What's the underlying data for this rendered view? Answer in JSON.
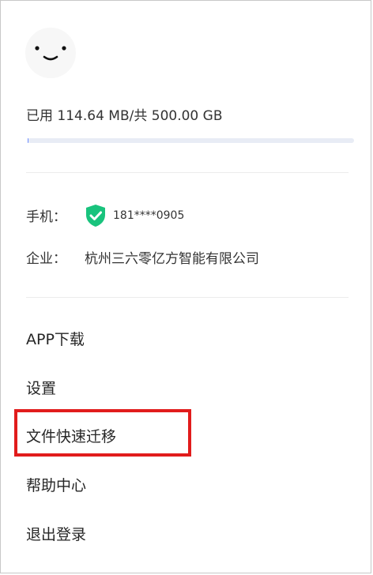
{
  "profile": {
    "avatar_icon": "smiley-face-icon"
  },
  "storage": {
    "text": "已用 114.64 MB/共 500.00 GB",
    "used_fraction": 0.0002,
    "track_color": "#e8ecf5",
    "fill_color": "#6b8cff"
  },
  "info": {
    "phone_label": "手机：",
    "phone_value": "181****0905",
    "verified_icon": "shield-check-icon",
    "verified_color": "#19c37d",
    "company_label": "企业：",
    "company_value": "杭州三六零亿方智能有限公司"
  },
  "menu": {
    "items": [
      {
        "label": "APP下载"
      },
      {
        "label": "设置"
      },
      {
        "label": "文件快速迁移"
      },
      {
        "label": "帮助中心"
      },
      {
        "label": "退出登录"
      }
    ]
  },
  "annotation": {
    "highlight_color": "#e11c1c"
  }
}
